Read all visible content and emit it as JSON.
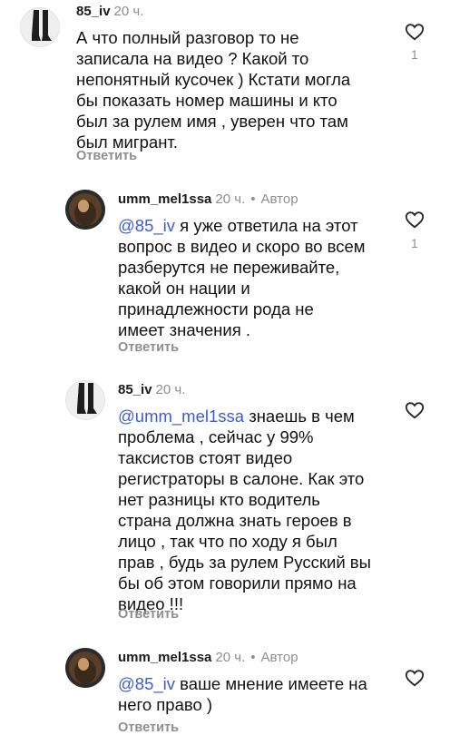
{
  "comments": [
    {
      "username": "85_iv",
      "time": "20 ч.",
      "text_lines": [
        "А что полный разговор то не",
        "записала на видео ? Какой то",
        "непонятный кусочек ) Кстати могла",
        "бы показать номер машины и кто",
        "был за рулем имя , уверен что там",
        "был мигрант."
      ],
      "reply_label": "Ответить",
      "like_count": "1"
    },
    {
      "username": "umm_mel1ssa",
      "time": "20 ч.",
      "dot": "•",
      "author_badge": "Автор",
      "mention": "@85_iv",
      "first_line_rest": " я уже ответила на этот",
      "text_lines": [
        "вопрос в видео и скоро во всем",
        "разберутся не переживайте,",
        "какой он нации и",
        "принадлежности рода не",
        "имеет значения ."
      ],
      "reply_label": "Ответить",
      "like_count": "1"
    },
    {
      "username": "85_iv",
      "time": "20 ч.",
      "mention": "@umm_mel1ssa",
      "first_line_rest": " знаешь в чем",
      "text_lines": [
        "проблема , сейчас у 99%",
        "таксистов стоят видео",
        "регистраторы в салоне. Как это",
        "нет разницы кто водитель",
        "страна должна знать героев в",
        "лицо , так что по ходу я был",
        "прав , будь за рулем Русский вы",
        "бы об этом говорили прямо на",
        "видео !!!"
      ],
      "reply_label": "Ответить"
    },
    {
      "username": "umm_mel1ssa",
      "time": "20 ч.",
      "dot": "•",
      "author_badge": "Автор",
      "mention": "@85_iv",
      "first_line_rest": " ваше мнение имеете на",
      "text_lines": [
        "него право )"
      ],
      "reply_label": "Ответить"
    }
  ],
  "icons": {
    "like": "heart-outline-icon",
    "avatar_85": "boots-photo-avatar",
    "avatar_umm": "round-photo-avatar"
  },
  "colors": {
    "mention": "#3b5bdb",
    "muted": "#8e8e8e"
  }
}
